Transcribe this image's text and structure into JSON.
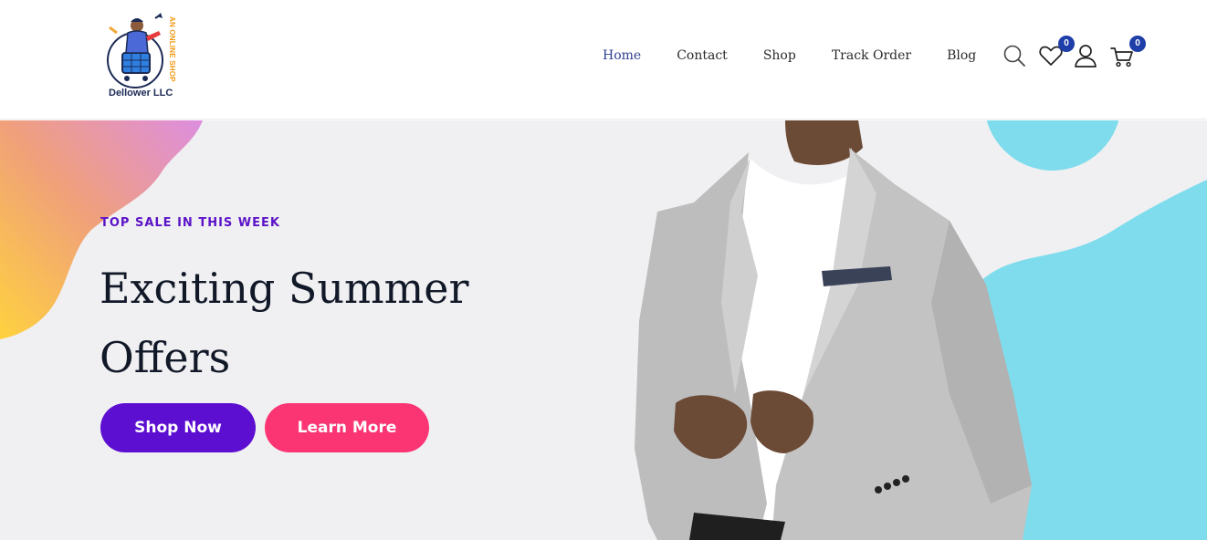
{
  "brand": {
    "name": "Dellower LLC",
    "tagline": "AN ONLINE SHOP"
  },
  "nav": {
    "items": [
      {
        "label": "Home",
        "active": true
      },
      {
        "label": "Contact",
        "active": false
      },
      {
        "label": "Shop",
        "active": false
      },
      {
        "label": "Track Order",
        "active": false
      },
      {
        "label": "Blog",
        "active": false
      }
    ]
  },
  "header_icons": {
    "search": "search-icon",
    "wishlist": {
      "icon": "heart-icon",
      "count": "0"
    },
    "account": "user-icon",
    "cart": {
      "icon": "cart-icon",
      "count": "0"
    }
  },
  "hero": {
    "kicker": "TOP SALE IN THIS WEEK",
    "headline_line1": "Exciting Summer",
    "headline_line2": "Offers",
    "primary_button": "Shop Now",
    "secondary_button": "Learn More",
    "image": "man-in-grey-blazer-photo"
  },
  "colors": {
    "accent_purple": "#5d0fd1",
    "accent_pink": "#fb3574",
    "badge_blue": "#1e3ea8",
    "nav_active": "#2f3f8f",
    "blob_cyan": "#7fdcec"
  }
}
